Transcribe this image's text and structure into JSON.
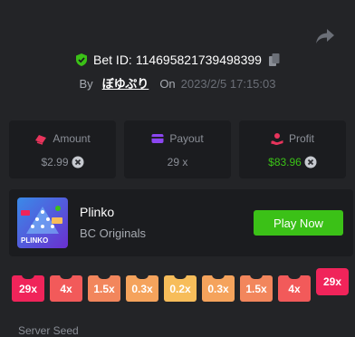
{
  "header": {
    "bet_id_label": "Bet ID:",
    "bet_id": "114695821739498399",
    "by_label": "By",
    "username": "ぼゆぷり",
    "on_label": "On",
    "date": "2023/2/5 17:15:03",
    "icons": {
      "share": "share-icon",
      "verified": "shield-check-icon",
      "copy": "copy-icon"
    }
  },
  "stats": [
    {
      "label": "Amount",
      "value": "$2.99",
      "icon": "coins-icon",
      "icon_color": "#e8345c"
    },
    {
      "label": "Payout",
      "value": "29 x",
      "icon": "wallet-icon",
      "icon_color": "#8c46f2"
    },
    {
      "label": "Profit",
      "value": "$83.96",
      "icon": "profit-icon",
      "icon_color": "#e8345c",
      "value_color": "#3bc117"
    }
  ],
  "game": {
    "thumbnail_text": "PLINKO",
    "name": "Plinko",
    "provider": "BC Originals",
    "play_label": "Play Now"
  },
  "multipliers": [
    {
      "label": "29x",
      "color": "#f0245a"
    },
    {
      "label": "4x",
      "color": "#f25a5a"
    },
    {
      "label": "1.5x",
      "color": "#f2865c"
    },
    {
      "label": "0.3x",
      "color": "#f5a35c"
    },
    {
      "label": "0.2x",
      "color": "#f7bd5a"
    },
    {
      "label": "0.3x",
      "color": "#f5a35c"
    },
    {
      "label": "1.5x",
      "color": "#f2865c"
    },
    {
      "label": "4x",
      "color": "#f25a5a"
    },
    {
      "label": "29x",
      "color": "#f0245a",
      "hit": true
    }
  ],
  "footer": {
    "seed_label": "Server Seed"
  }
}
